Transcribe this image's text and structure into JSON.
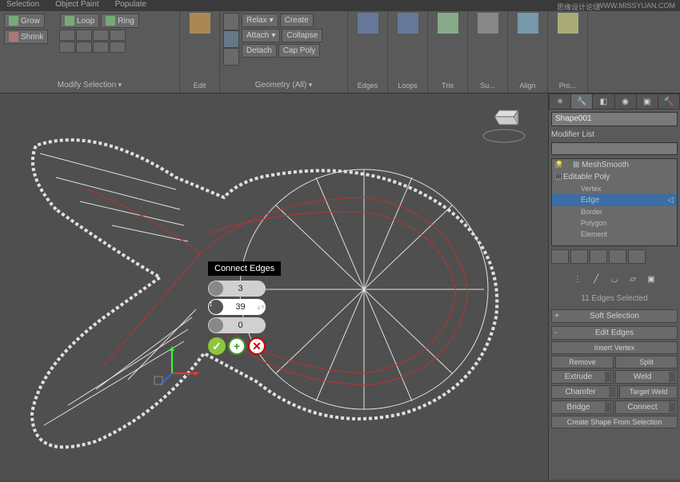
{
  "watermark": {
    "text1": "思缘设计论坛",
    "text2": "WWW.MISSYUAN.COM"
  },
  "topbar": {
    "selection": "Selection",
    "objpaint": "Object Paint",
    "populate": "Populate"
  },
  "ribbon": {
    "sel": {
      "grow": "Grow",
      "shrink": "Shrink",
      "loop": "Loop",
      "ring": "Ring",
      "label": "Modify Selection"
    },
    "edit": {
      "label": "Edit"
    },
    "geom": {
      "relax": "Relax",
      "create": "Create",
      "attach": "Attach",
      "collapse": "Collapse",
      "detach": "Detach",
      "cappoly": "Cap Poly",
      "label": "Geometry (All)"
    },
    "tools": {
      "edges": "Edges",
      "loops": "Loops",
      "tris": "Tris",
      "subd": "Su...",
      "align": "Align",
      "prop": "Pro..."
    }
  },
  "popup": {
    "title": "Connect Edges",
    "segments": "3",
    "pinch": "39",
    "slide": "0"
  },
  "panel": {
    "objname": "Shape001",
    "modlist_label": "Modifier List",
    "stack": {
      "meshsmooth": "MeshSmooth",
      "editpoly": "Editable Poly",
      "vertex": "Vertex",
      "edge": "Edge",
      "border": "Border",
      "polygon": "Polygon",
      "element": "Element"
    },
    "info": "11 Edges Selected",
    "rollouts": {
      "softsel": "Soft Selection",
      "editedges": "Edit Edges",
      "insertv": "Insert Vertex",
      "remove": "Remove",
      "split": "Split",
      "extrude": "Extrude",
      "weld": "Weld",
      "chamfer": "Chamfer",
      "tweld": "Target Weld",
      "bridge": "Bridge",
      "connect": "Connect",
      "cshape": "Create Shape From Selection"
    }
  }
}
